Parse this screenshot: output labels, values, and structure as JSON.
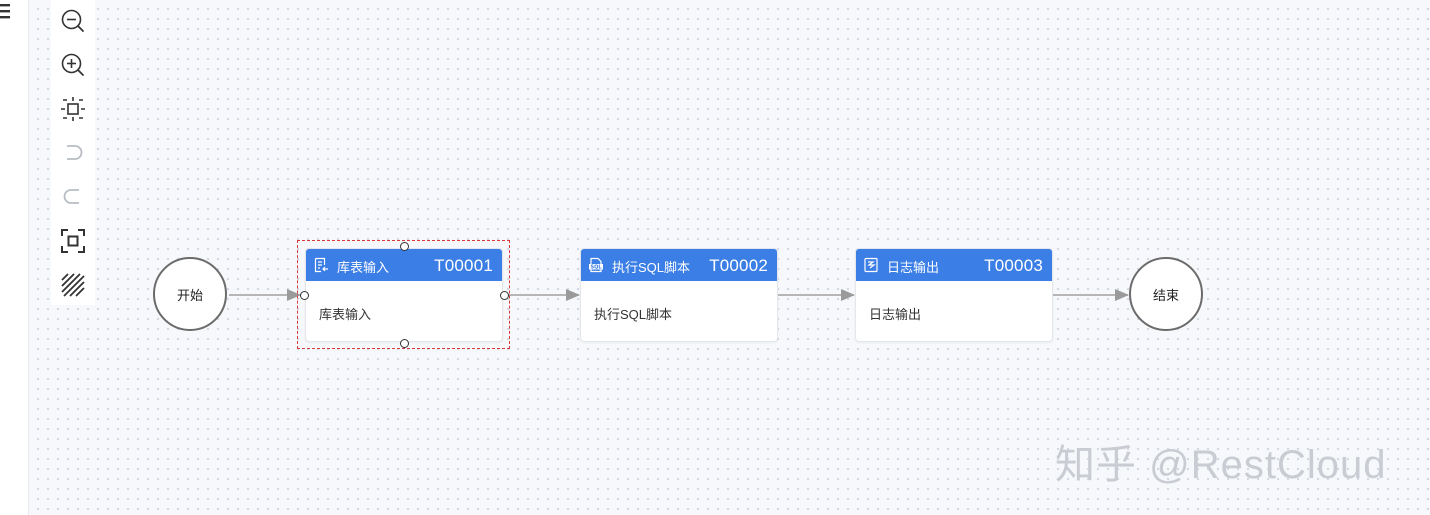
{
  "toolbar": {
    "items": [
      {
        "icon": "zoom-out-icon",
        "enabled": true
      },
      {
        "icon": "zoom-in-icon",
        "enabled": true
      },
      {
        "icon": "fit-view-icon",
        "enabled": true
      },
      {
        "icon": "undo-icon",
        "enabled": false
      },
      {
        "icon": "redo-icon",
        "enabled": false
      },
      {
        "icon": "actual-size-icon",
        "enabled": true
      },
      {
        "icon": "grid-toggle-icon",
        "enabled": true
      }
    ]
  },
  "flow": {
    "start": {
      "label": "开始"
    },
    "end": {
      "label": "结束"
    },
    "tasks": [
      {
        "name": "库表输入",
        "id": "T00001",
        "body": "库表输入",
        "icon": "table-input-icon",
        "selected": true
      },
      {
        "name": "执行SQL脚本",
        "id": "T00002",
        "body": "执行SQL脚本",
        "icon": "sql-script-icon",
        "selected": false
      },
      {
        "name": "日志输出",
        "id": "T00003",
        "body": "日志输出",
        "icon": "log-output-icon",
        "selected": false
      }
    ]
  },
  "colors": {
    "node_header": "#3b7ee6",
    "selection": "#d63a3a",
    "edge": "#999999",
    "canvas": "#f6f8fb"
  },
  "watermark": {
    "text": "知乎 @RestCloud"
  }
}
